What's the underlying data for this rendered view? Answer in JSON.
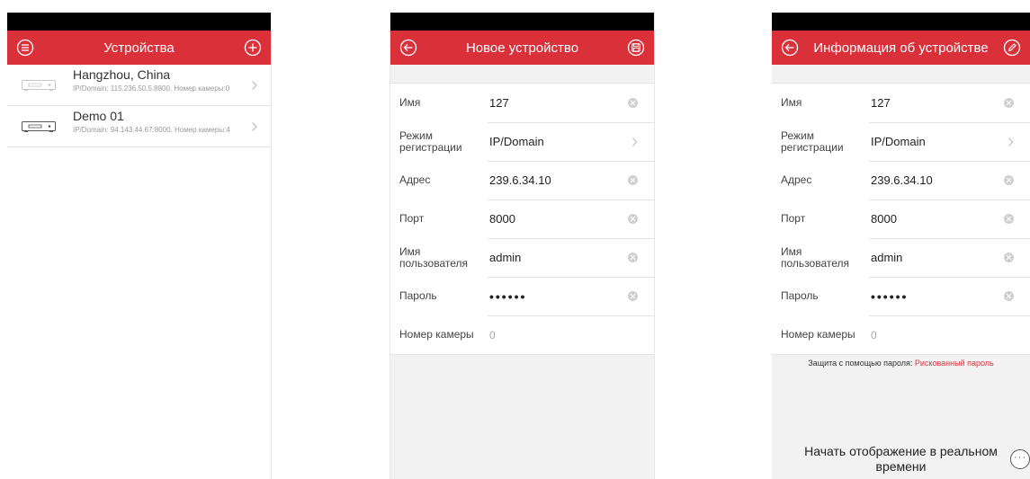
{
  "screen1": {
    "title": "Устройства",
    "devices": [
      {
        "name": "Hangzhou, China",
        "sub": "IP/Domain: 115.236.50.5:8800, Номер камеры:0"
      },
      {
        "name": "Demo 01",
        "sub": "IP/Domain: 94.143.44.67:8000, Номер камеры:4"
      }
    ]
  },
  "screen2": {
    "title": "Новое устройство",
    "fields": {
      "name_label": "Имя",
      "name_value": "127",
      "mode_label": "Режим регистрации",
      "mode_value": "IP/Domain",
      "addr_label": "Адрес",
      "addr_value": "239.6.34.10",
      "port_label": "Порт",
      "port_value": "8000",
      "user_label": "Имя пользователя",
      "user_value": "admin",
      "pass_label": "Пароль",
      "pass_value": "••••••",
      "cam_label": "Номер камеры",
      "cam_value": "0"
    }
  },
  "screen3": {
    "title": "Информация об устройстве",
    "fields": {
      "name_label": "Имя",
      "name_value": "127",
      "mode_label": "Режим регистрации",
      "mode_value": "IP/Domain",
      "addr_label": "Адрес",
      "addr_value": "239.6.34.10",
      "port_label": "Порт",
      "port_value": "8000",
      "user_label": "Имя пользователя",
      "user_value": "admin",
      "pass_label": "Пароль",
      "pass_value": "••••••",
      "cam_label": "Номер камеры",
      "cam_value": "0"
    },
    "pw_protect_label": "Защита с помощью пароля:",
    "pw_protect_value": "Рискованный пароль",
    "live_button": "Начать отображение в реальном времени",
    "more_icon_glyph": "···"
  },
  "colors": {
    "accent": "#d9303a",
    "risk": "#e0323c"
  }
}
